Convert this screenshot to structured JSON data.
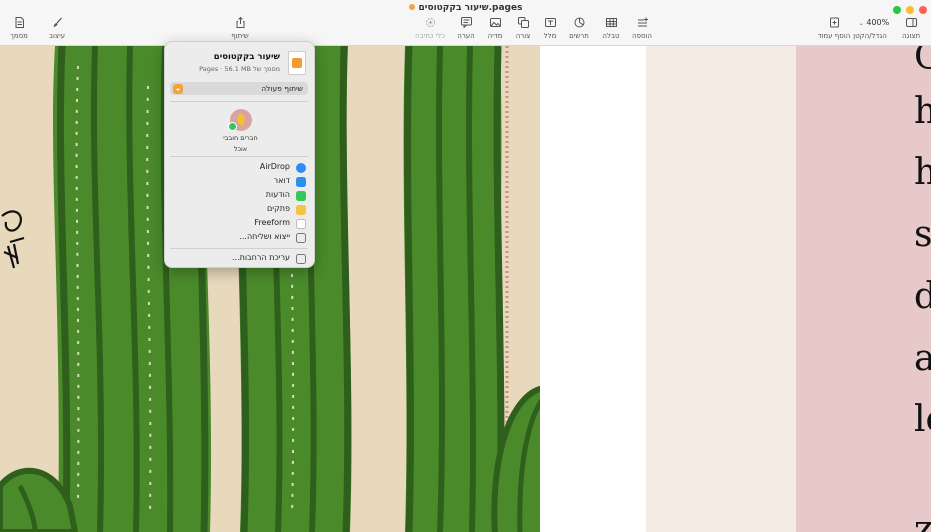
{
  "window": {
    "title": "שיעור בקקטוסים.pages",
    "traffic_lights": {
      "close": "#ff5f57",
      "minimize": "#febc2e",
      "zoom": "#28c840"
    }
  },
  "toolbar": {
    "view": "תצוגה",
    "zoom_value": "400%",
    "zoom_label": "הגדל/הקטן",
    "add_page": "הוסף עמוד",
    "insert": "הוספה",
    "table": "טבלה",
    "chart": "תרשים",
    "text": "מלל",
    "shape": "צורה",
    "media": "מדיה",
    "comment": "הערה",
    "writing_tools": "כלי כתיבה",
    "share": "שיתוף",
    "format": "עיצוב",
    "document": "מסמך"
  },
  "share_popover": {
    "file_name": "שיעור בקקטוסים",
    "file_meta": "מסמך של Pages · 56.1 MB",
    "collaborate": "שיתוף פעולה",
    "contact_line1": "חברים חובבי",
    "contact_line2": "אוכל",
    "items": [
      {
        "label": "AirDrop",
        "icon": "airdrop-icon",
        "color": "#2f8cf5"
      },
      {
        "label": "דואר",
        "icon": "mail-icon",
        "color": "#2c8ff0"
      },
      {
        "label": "הודעות",
        "icon": "messages-icon",
        "color": "#34c759"
      },
      {
        "label": "פתקים",
        "icon": "notes-icon",
        "color": "#f6c443"
      },
      {
        "label": "Freeform",
        "icon": "freeform-icon",
        "color": "#3a7bd5"
      },
      {
        "label": "ייצוא ושליחה...",
        "icon": "export-icon",
        "color": "#7a7a7a"
      }
    ],
    "edit_extensions": "עריכת הרחבות..."
  },
  "document": {
    "glyphs": [
      "O",
      "h",
      "h",
      "s",
      "d",
      "a",
      "le",
      "z"
    ]
  },
  "colors": {
    "cactus_green": "#4a8a2b",
    "cactus_dark": "#2f5f1c",
    "cactus_background": "#e8d9bd",
    "pink_panel": "#e6c9c8",
    "cream_panel": "#f4ece4"
  }
}
